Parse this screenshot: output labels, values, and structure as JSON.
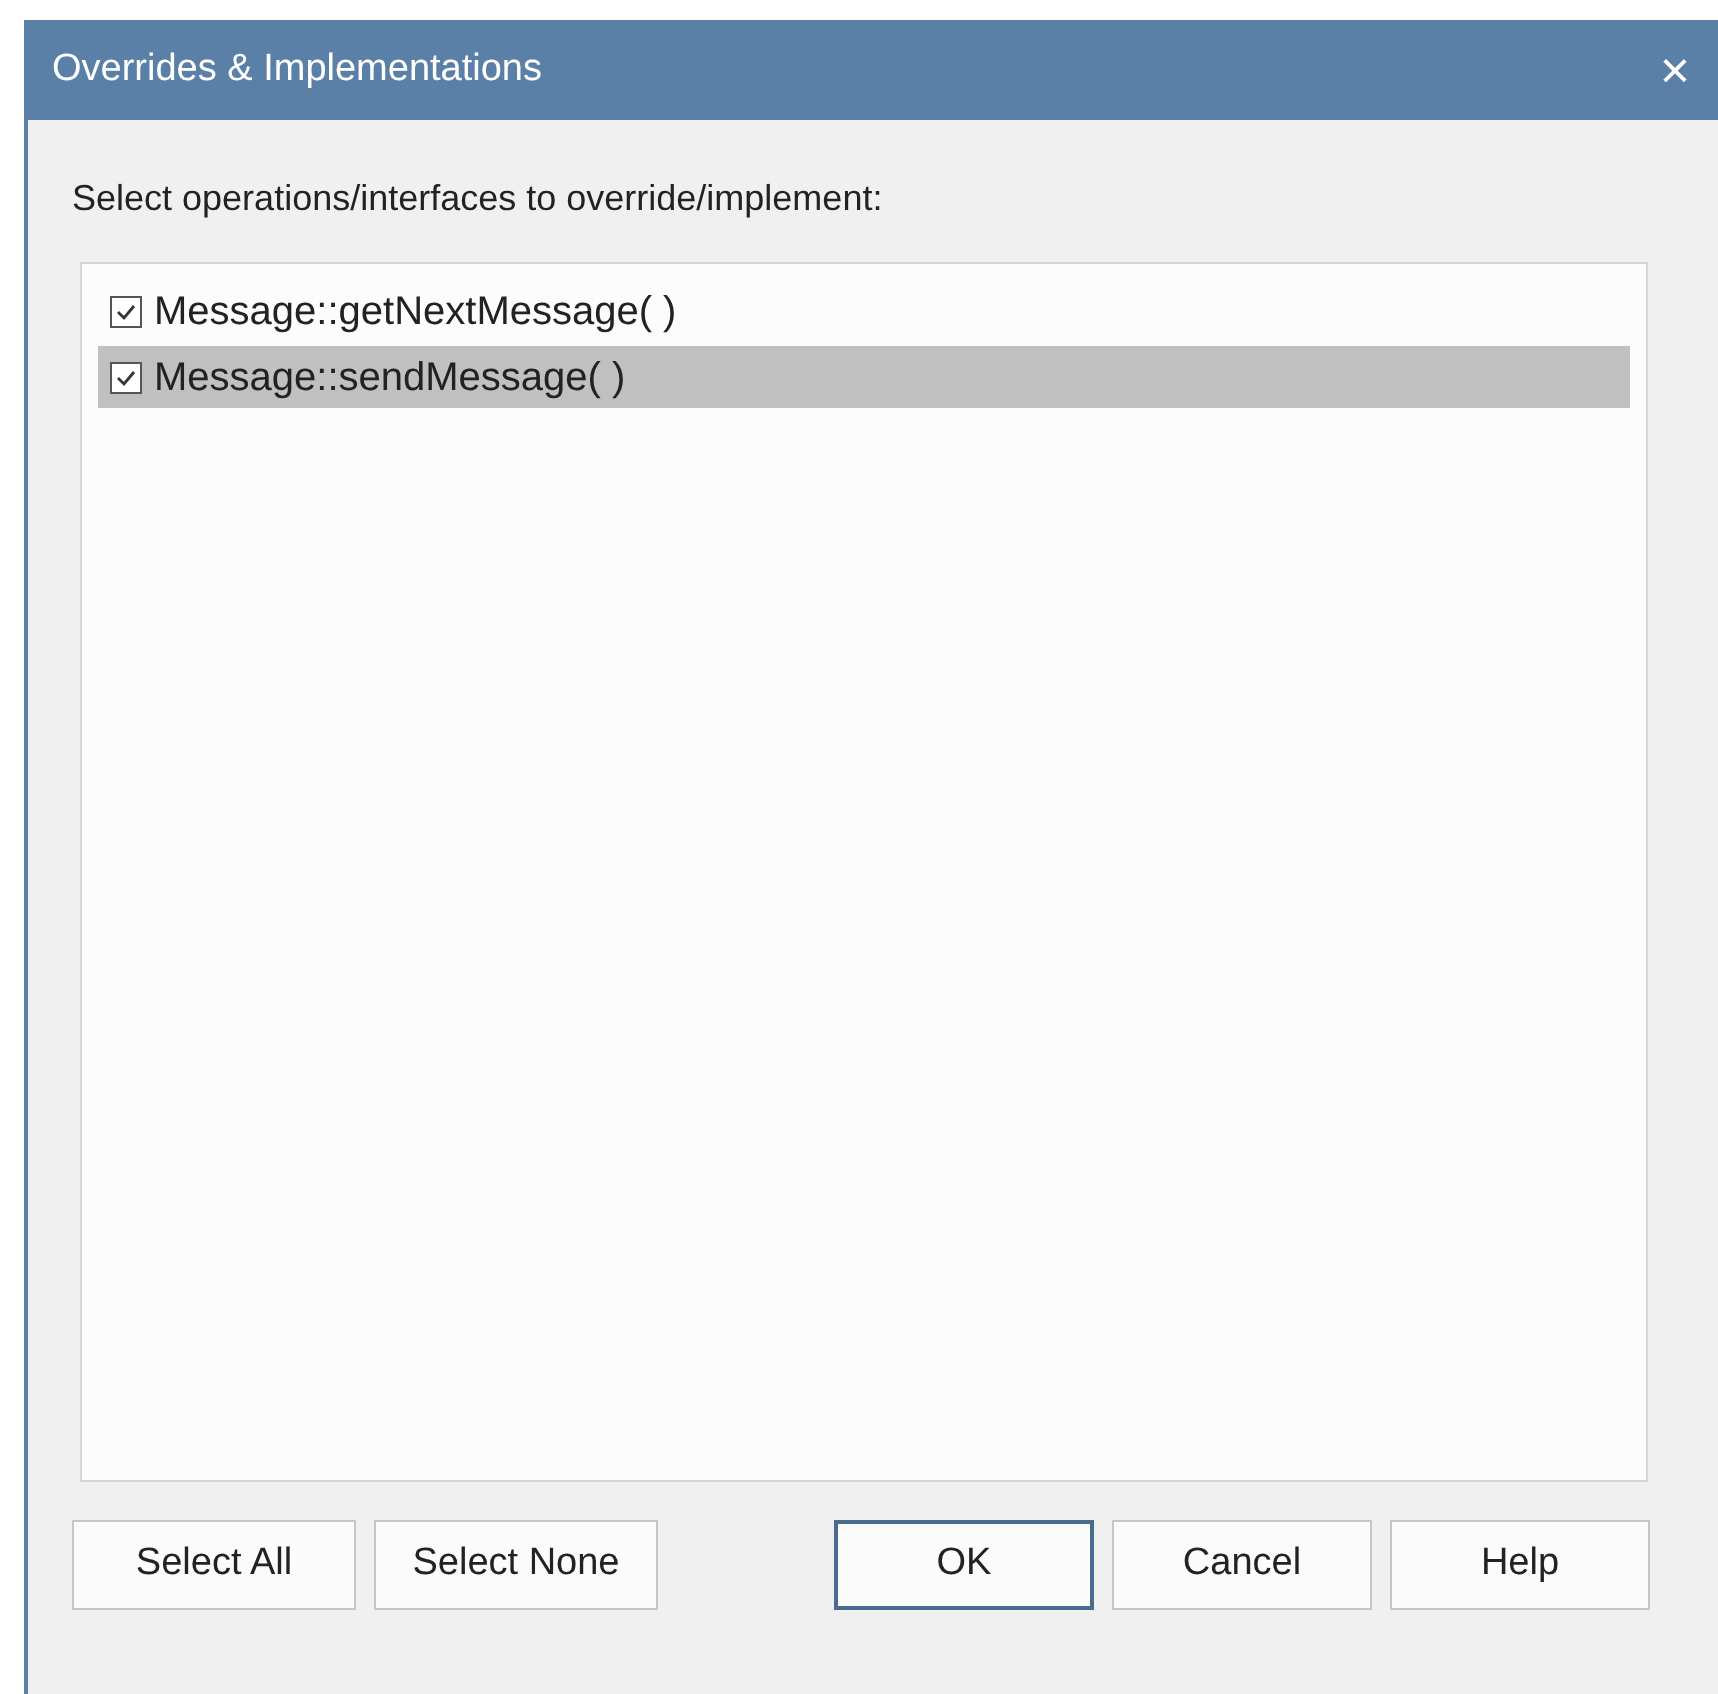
{
  "window": {
    "title": "Overrides & Implementations",
    "close": "×"
  },
  "prompt": "Select operations/interfaces to override/implement:",
  "items": [
    {
      "label": "Message::getNextMessage( )",
      "checked": true,
      "selected": false
    },
    {
      "label": "Message::sendMessage( )",
      "checked": true,
      "selected": true
    }
  ],
  "left_buttons": [
    {
      "label": "Select All",
      "default": false
    },
    {
      "label": "Select None",
      "default": false
    }
  ],
  "right_buttons": [
    {
      "label": "OK",
      "default": true
    },
    {
      "label": "Cancel",
      "default": false
    },
    {
      "label": "Help",
      "default": false
    }
  ]
}
